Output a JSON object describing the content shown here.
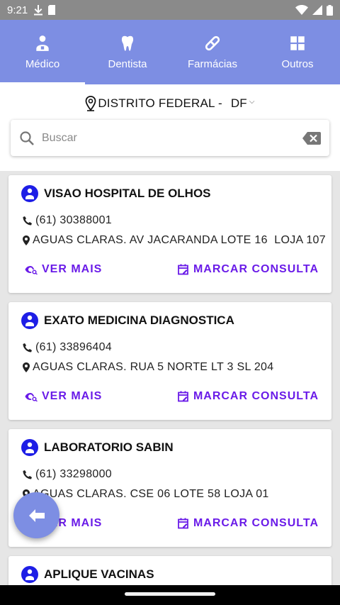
{
  "status_bar": {
    "time": "9:21"
  },
  "tabs": [
    {
      "label": "Médico",
      "icon": "doctor-icon",
      "active": true
    },
    {
      "label": "Dentista",
      "icon": "tooth-icon",
      "active": false
    },
    {
      "label": "Farmácias",
      "icon": "pill-icon",
      "active": false
    },
    {
      "label": "Outros",
      "icon": "grid-icon",
      "active": false
    }
  ],
  "region": {
    "name": "DISTRITO FEDERAL -",
    "uf": "DF"
  },
  "search": {
    "placeholder": "Buscar",
    "value": ""
  },
  "cards": [
    {
      "name": "VISAO HOSPITAL DE OLHOS",
      "phone": "(61) 30388001",
      "address": "AGUAS CLARAS. AV JACARANDA LOTE 16  LOJA 107",
      "more_label": "VER MAIS",
      "book_label": "MARCAR CONSULTA"
    },
    {
      "name": "EXATO MEDICINA DIAGNOSTICA",
      "phone": "(61) 33896404",
      "address": "AGUAS CLARAS. RUA 5 NORTE LT 3 SL 204",
      "more_label": "VER MAIS",
      "book_label": "MARCAR CONSULTA"
    },
    {
      "name": "LABORATORIO SABIN",
      "phone": "(61) 33298000",
      "address": "AGUAS CLARAS. CSE 06 LOTE 58 LOJA 01",
      "more_label": "VER MAIS",
      "book_label": "MARCAR CONSULTA"
    },
    {
      "name": "APLIQUE VACINAS"
    }
  ],
  "colors": {
    "primary": "#7d8ee3",
    "accent": "#6a1be8",
    "avatar": "#1e1ee6"
  }
}
